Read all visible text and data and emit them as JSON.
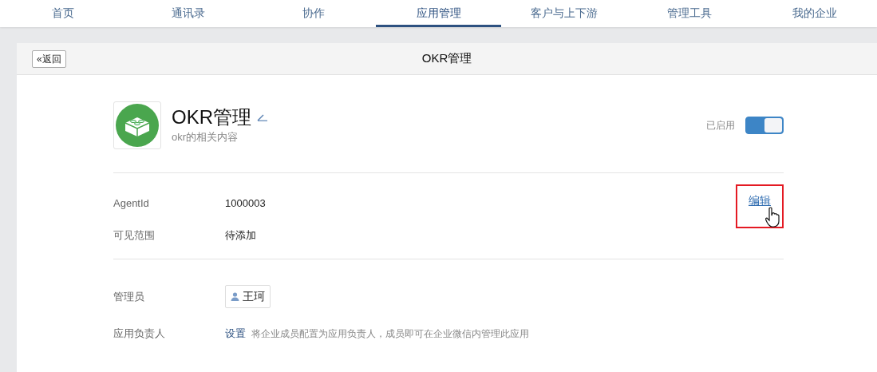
{
  "nav": [
    {
      "label": "首页",
      "selected": false
    },
    {
      "label": "通讯录",
      "selected": false
    },
    {
      "label": "协作",
      "selected": false
    },
    {
      "label": "应用管理",
      "selected": true
    },
    {
      "label": "客户与上下游",
      "selected": false
    },
    {
      "label": "管理工具",
      "selected": false
    },
    {
      "label": "我的企业",
      "selected": false
    }
  ],
  "header": {
    "back": "返回",
    "back_icon": "«",
    "title": "OKR管理"
  },
  "app": {
    "name": "OKR管理",
    "description": "okr的相关内容",
    "status": "已启用",
    "enabled": true
  },
  "info": {
    "edit": {
      "label": "编辑",
      "highlighted": true
    },
    "rows": [
      {
        "label": "AgentId",
        "value": "1000003"
      },
      {
        "label": "可见范围",
        "value": "待添加"
      }
    ]
  },
  "admins": {
    "label": "管理员",
    "people": [
      "王珂"
    ]
  },
  "owner": {
    "label": "应用负责人",
    "link": "设置",
    "hint": "将企业成员配置为应用负责人，成员即可在企业微信内管理此应用"
  }
}
